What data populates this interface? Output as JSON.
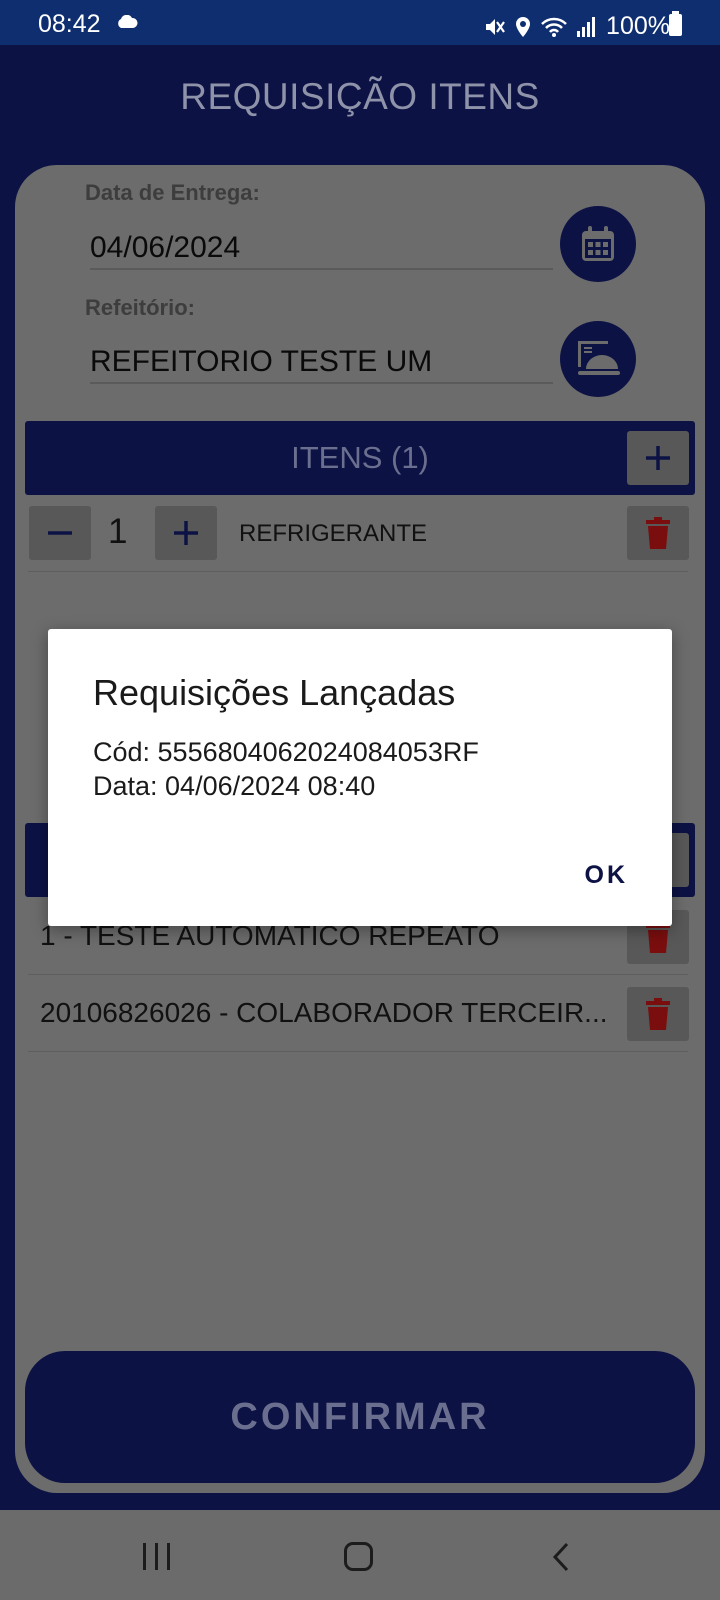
{
  "status_bar": {
    "time": "08:42",
    "battery": "100%",
    "icons": [
      "cloud-icon",
      "mute-icon",
      "location-icon",
      "wifi-icon",
      "signal-icon",
      "battery-icon"
    ]
  },
  "screen": {
    "title": "REQUISIÇÃO ITENS"
  },
  "form": {
    "delivery_label": "Data de Entrega:",
    "delivery_value": "04/06/2024",
    "cafeteria_label": "Refeitório:",
    "cafeteria_value": "REFEITORIO TESTE UM"
  },
  "items_section": {
    "header": "ITENS (1)",
    "items": [
      {
        "quantity": "1",
        "name": "REFRIGERANTE"
      }
    ]
  },
  "people_list": {
    "entries": [
      "1 - TESTE AUTOMATICO REPEATO",
      "20106826026 - COLABORADOR TERCEIR..."
    ]
  },
  "confirm_button": "CONFIRMAR",
  "dialog": {
    "title": "Requisições Lançadas",
    "code_line": "Cód: 5556804062024084053RF",
    "date_line": "Data: 04/06/2024 08:40",
    "ok_label": "OK"
  },
  "colors": {
    "primary": "#0c1244",
    "overlay_bg": "#6c6c6c",
    "delete": "#7a0e0e"
  }
}
